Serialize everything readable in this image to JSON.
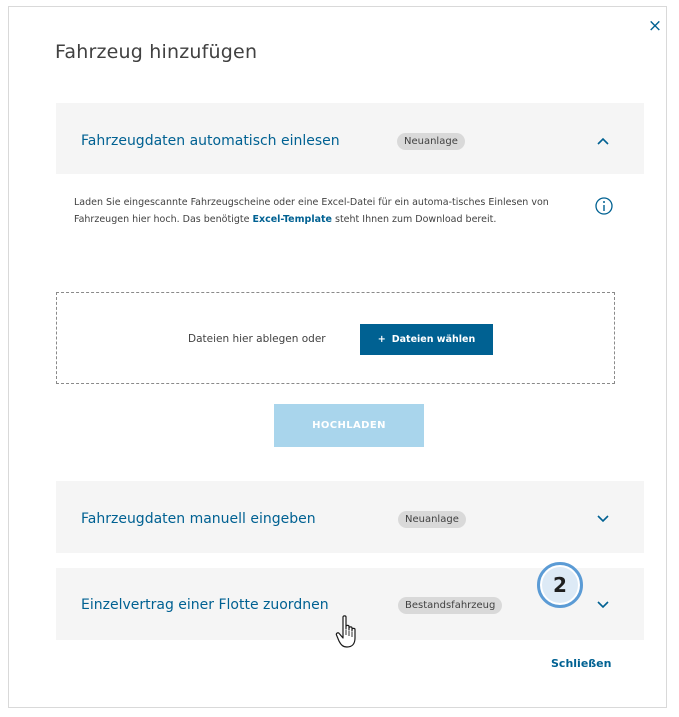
{
  "dialog": {
    "title": "Fahrzeug hinzufügen",
    "close_icon": "×",
    "close_link": "Schließen"
  },
  "sections": [
    {
      "title": "Fahrzeugdaten automatisch einlesen",
      "badge": "Neuanlage",
      "expanded": true
    },
    {
      "title": "Fahrzeugdaten manuell eingeben",
      "badge": "Neuanlage",
      "expanded": false
    },
    {
      "title": "Einzelvertrag einer Flotte zuordnen",
      "badge": "Bestandsfahrzeug",
      "expanded": false
    }
  ],
  "upload": {
    "desc_part1": "Laden Sie eingescannte Fahrzeugscheine oder eine Excel-Datei für ein automa-tisches Einlesen von Fahrzeugen hier hoch. Das benötigte ",
    "desc_link": "Excel-Template",
    "desc_part2": " steht Ihnen zum Download bereit.",
    "drop_text": "Dateien hier ablegen oder",
    "choose_plus": "+",
    "choose_label": "Dateien wählen",
    "upload_label": "HOCHLADEN",
    "upload_enabled": false
  },
  "annotation": {
    "step": "2"
  },
  "colors": {
    "primary": "#006192",
    "accordion_bg": "#f5f5f5",
    "badge_bg": "#d9d9d9",
    "disabled_btn": "#a9d5ec",
    "step_ring": "#5b9bd5"
  },
  "icons": {
    "info": "info-icon",
    "chevron_up": "chevron-up-icon",
    "chevron_down": "chevron-down-icon",
    "cursor": "hand-pointer-icon"
  }
}
